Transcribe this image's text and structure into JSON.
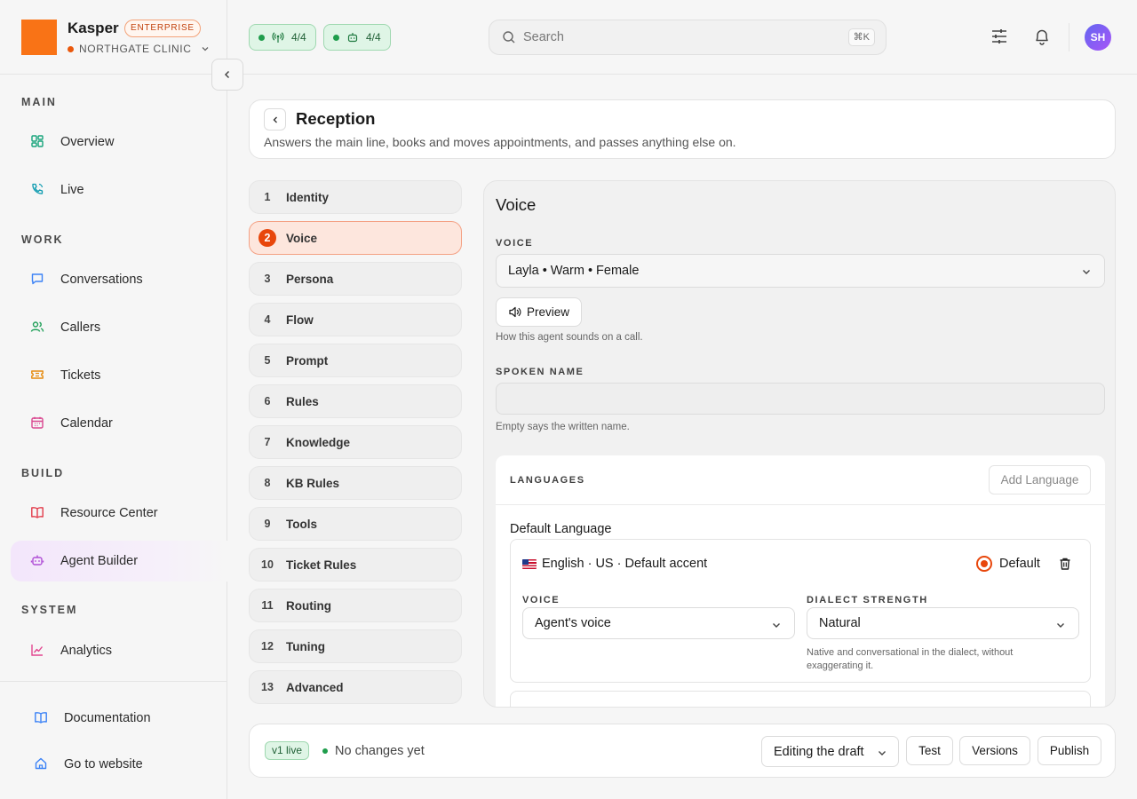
{
  "brand": {
    "name": "Kasper",
    "badge": "ENTERPRISE",
    "org": "NORTHGATE CLINIC"
  },
  "status_pills": [
    {
      "icon": "antenna-icon",
      "value": "4/4"
    },
    {
      "icon": "bot-icon",
      "value": "4/4"
    }
  ],
  "search": {
    "placeholder": "Search",
    "shortcut": "⌘K"
  },
  "user": {
    "initials": "SH"
  },
  "sidebar": {
    "sections": {
      "main": "MAIN",
      "work": "WORK",
      "build": "BUILD",
      "system": "SYSTEM"
    },
    "items": [
      {
        "label": "Overview",
        "icon": "grid-icon"
      },
      {
        "label": "Live",
        "icon": "phone-icon"
      },
      {
        "label": "Conversations",
        "icon": "chat-icon"
      },
      {
        "label": "Callers",
        "icon": "users-icon"
      },
      {
        "label": "Tickets",
        "icon": "ticket-icon"
      },
      {
        "label": "Calendar",
        "icon": "calendar-icon"
      },
      {
        "label": "Resource Center",
        "icon": "book-icon"
      },
      {
        "label": "Agent Builder",
        "icon": "bot-icon",
        "active": true
      },
      {
        "label": "Analytics",
        "icon": "chart-icon"
      }
    ],
    "bottom": [
      {
        "label": "Documentation",
        "icon": "book-open-icon"
      },
      {
        "label": "Go to website",
        "icon": "home-icon"
      }
    ]
  },
  "page": {
    "title": "Reception",
    "subtitle": "Answers the main line, books and moves appointments, and passes anything else on."
  },
  "steps": [
    {
      "num": "1",
      "label": "Identity"
    },
    {
      "num": "2",
      "label": "Voice",
      "active": true
    },
    {
      "num": "3",
      "label": "Persona"
    },
    {
      "num": "4",
      "label": "Flow"
    },
    {
      "num": "5",
      "label": "Prompt"
    },
    {
      "num": "6",
      "label": "Rules"
    },
    {
      "num": "7",
      "label": "Knowledge"
    },
    {
      "num": "8",
      "label": "KB Rules"
    },
    {
      "num": "9",
      "label": "Tools"
    },
    {
      "num": "10",
      "label": "Ticket Rules"
    },
    {
      "num": "11",
      "label": "Routing"
    },
    {
      "num": "12",
      "label": "Tuning"
    },
    {
      "num": "13",
      "label": "Advanced"
    }
  ],
  "voice_panel": {
    "title": "Voice",
    "voice_label": "VOICE",
    "voice_value": "Layla • Warm • Female",
    "preview_label": "Preview",
    "voice_help": "How this agent sounds on a call.",
    "spoken_name_label": "SPOKEN NAME",
    "spoken_name_value": "",
    "spoken_name_help": "Empty says the written name.",
    "languages": {
      "title": "LANGUAGES",
      "add_label": "Add Language",
      "default_title": "Default Language",
      "default": {
        "name": "English · US · Default accent",
        "default_label": "Default",
        "voice_label": "VOICE",
        "voice_value": "Agent's voice",
        "dialect_label": "DIALECT STRENGTH",
        "dialect_value": "Natural",
        "dialect_help": "Native and conversational in the dialect, without exaggerating it."
      }
    }
  },
  "footer": {
    "live_badge": "v1 live",
    "status": "No changes yet",
    "mode": "Editing the draft",
    "test_label": "Test",
    "versions_label": "Versions",
    "publish_label": "Publish"
  },
  "colors": {
    "accent": "#e8470c",
    "brand": "#f97316",
    "live_green": "#1f9d4c",
    "active_nav": "#f3e6fb"
  }
}
